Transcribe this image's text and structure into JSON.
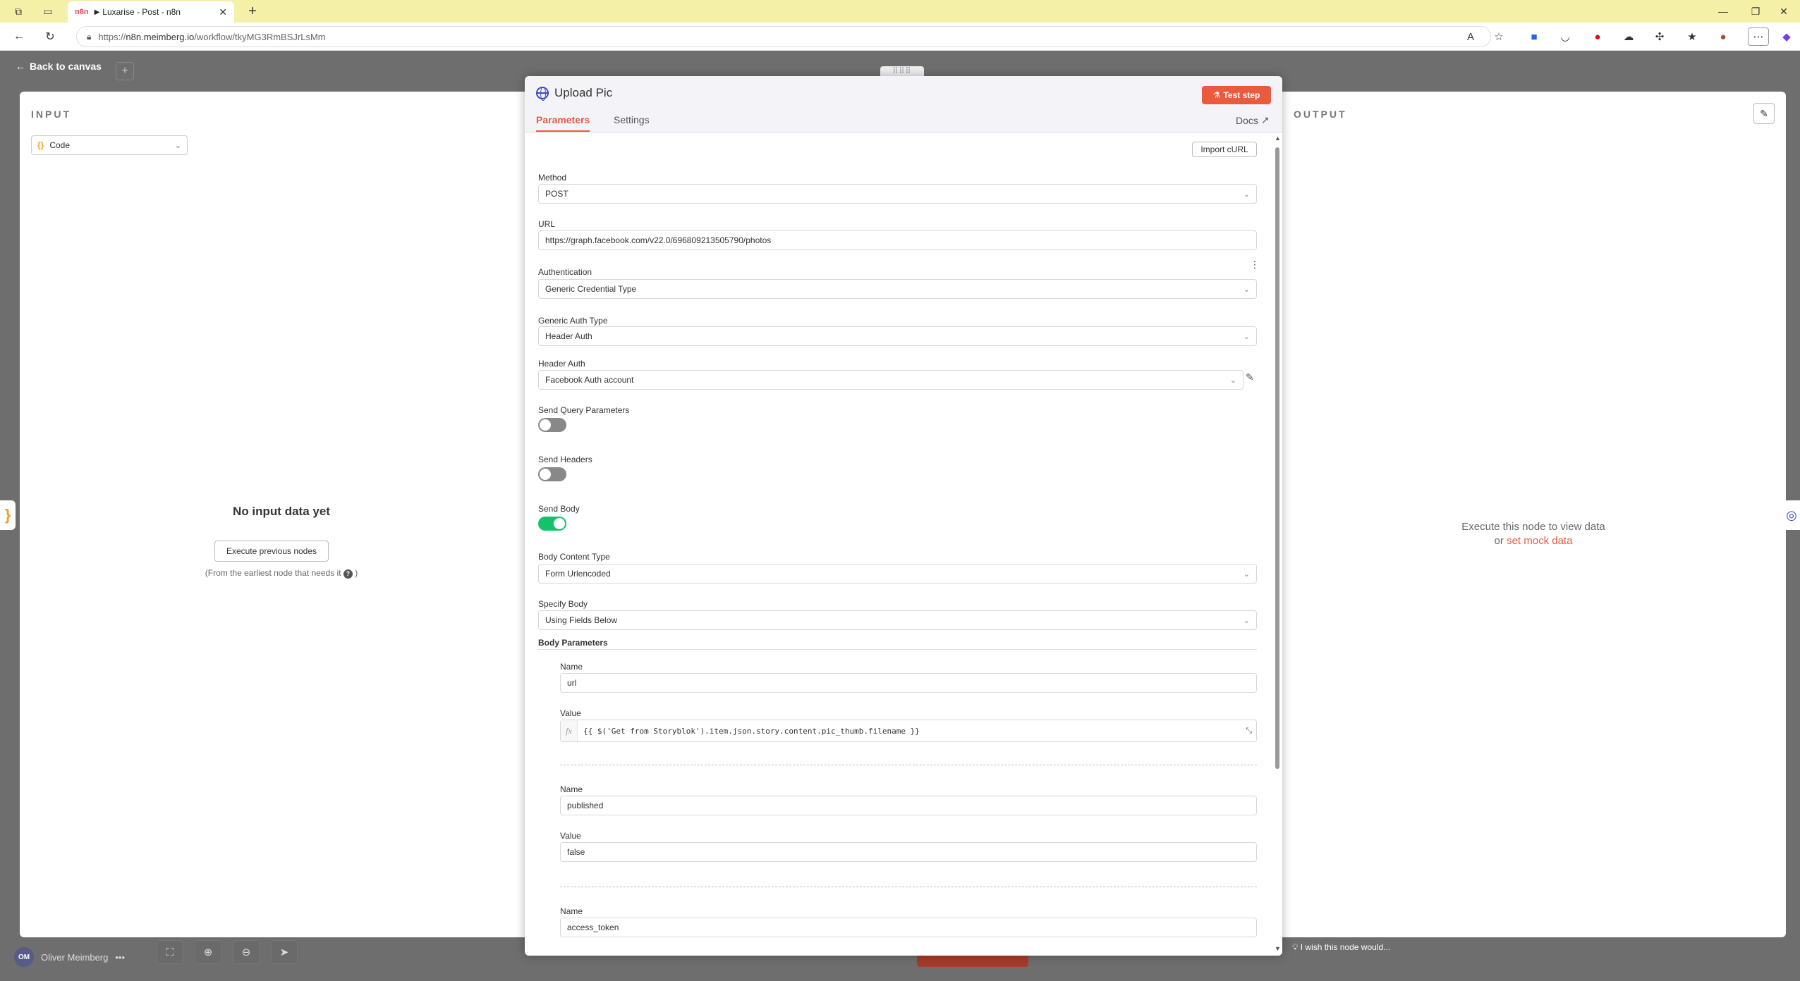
{
  "browser": {
    "tab_title": "Luxarise - Post - n8n",
    "tab_favicon": "n8n",
    "url_scheme": "https://",
    "url_host": "n8n.meimberg.io",
    "url_path": "/workflow/tkyMG3RmBSJrLsMm",
    "accent": "#f5f0a8"
  },
  "app": {
    "back_label": "Back to canvas"
  },
  "input_panel": {
    "title": "INPUT",
    "source_select": "Code",
    "no_data": "No input data yet",
    "execute_button": "Execute previous nodes",
    "hint": "(From the earliest node that needs it",
    "hint_end": ")"
  },
  "output_panel": {
    "title": "OUTPUT",
    "message_line1": "Execute this node to view data",
    "message_or": "or",
    "mock_link": "set mock data",
    "wish": "I wish this node would..."
  },
  "user": {
    "initials": "OM",
    "name": "Oliver Meimberg"
  },
  "node": {
    "title": "Upload Pic",
    "test_step": "Test step",
    "tabs": {
      "parameters": "Parameters",
      "settings": "Settings",
      "docs": "Docs"
    },
    "import_curl": "Import cURL",
    "fields": {
      "method_label": "Method",
      "method_value": "POST",
      "url_label": "URL",
      "url_value": "https://graph.facebook.com/v22.0/696809213505790/photos",
      "auth_label": "Authentication",
      "auth_value": "Generic Credential Type",
      "generic_auth_label": "Generic Auth Type",
      "generic_auth_value": "Header Auth",
      "header_auth_label": "Header Auth",
      "header_auth_value": "Facebook Auth account",
      "send_query_label": "Send Query Parameters",
      "send_query_on": false,
      "send_headers_label": "Send Headers",
      "send_headers_on": false,
      "send_body_label": "Send Body",
      "send_body_on": true,
      "body_content_label": "Body Content Type",
      "body_content_value": "Form Urlencoded",
      "specify_body_label": "Specify Body",
      "specify_body_value": "Using Fields Below",
      "body_params_label": "Body Parameters"
    },
    "body_params": [
      {
        "name_label": "Name",
        "name": "url",
        "value_label": "Value",
        "value": "{{ $('Get from Storyblok').item.json.story.content.pic_thumb.filename }}"
      },
      {
        "name_label": "Name",
        "name": "published",
        "value_label": "Value",
        "value": "false"
      },
      {
        "name_label": "Name",
        "name": "access_token"
      }
    ],
    "accent": "#ea5b3e",
    "toggle_on_color": "#13c26b"
  }
}
